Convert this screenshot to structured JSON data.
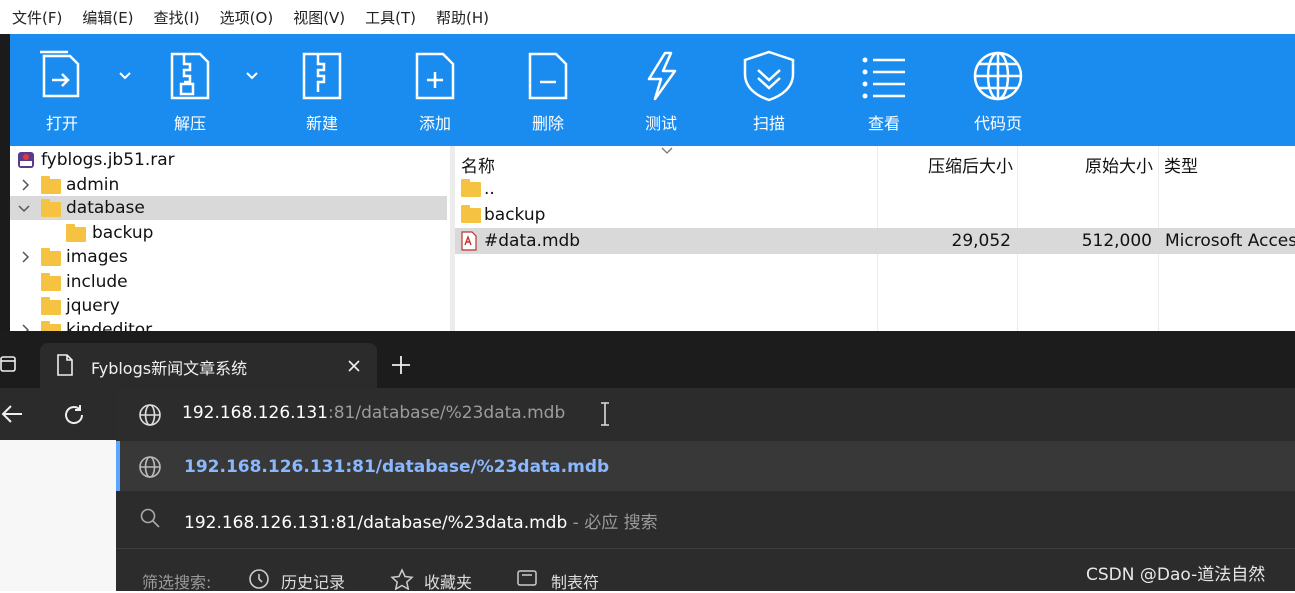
{
  "menu": [
    "文件(F)",
    "编辑(E)",
    "查找(I)",
    "选项(O)",
    "视图(V)",
    "工具(T)",
    "帮助(H)"
  ],
  "toolbar": {
    "buttons": [
      "打开",
      "解压",
      "新建",
      "添加",
      "删除",
      "测试",
      "扫描",
      "查看",
      "代码页"
    ],
    "color": "#1a8cf0"
  },
  "tree": {
    "archive": "fyblogs.jb51.rar",
    "items": [
      "admin",
      "database",
      "backup",
      "images",
      "include",
      "jquery",
      "kindeditor"
    ]
  },
  "list": {
    "headers": {
      "name": "名称",
      "packed": "压缩后大小",
      "size": "原始大小",
      "type": "类型"
    },
    "rows": [
      {
        "name": "..",
        "packed": "",
        "size": "",
        "type": ""
      },
      {
        "name": "backup",
        "packed": "",
        "size": "",
        "type": ""
      },
      {
        "name": "#data.mdb",
        "packed": "29,052",
        "size": "512,000",
        "type": "Microsoft Access"
      }
    ]
  },
  "browser": {
    "tab_title": "Fyblogs新闻文章系统",
    "address": {
      "host": "192.168.126.131",
      "rest": ":81/database/%23data.mdb"
    },
    "suggestion_url": "192.168.126.131:81/database/%23data.mdb",
    "suggestion_search": {
      "query": "192.168.126.131:81/database/%23data.mdb",
      "suffix": " - 必应 搜索"
    },
    "filter": {
      "label": "筛选搜索:",
      "history": "历史记录",
      "favorites": "收藏夹",
      "tabs": "制表符"
    }
  },
  "watermark": "CSDN @Dao-道法自然"
}
